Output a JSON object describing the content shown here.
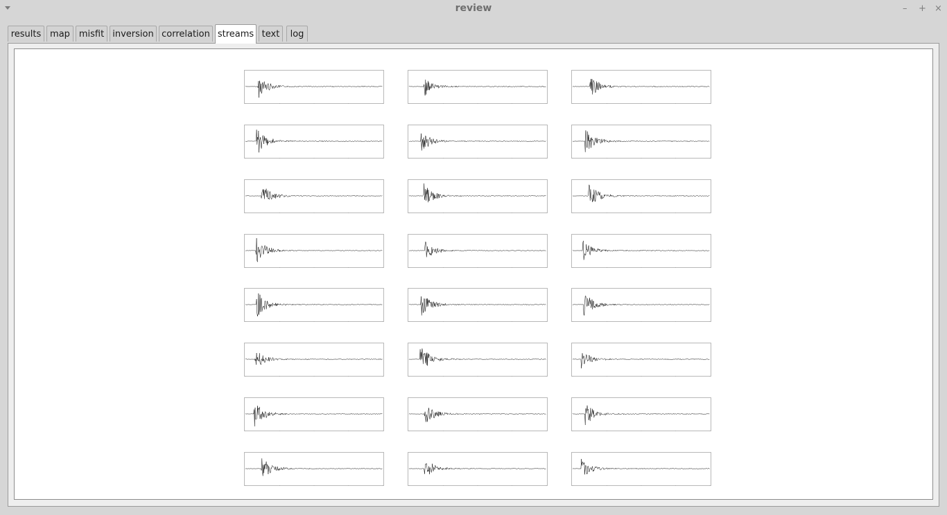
{
  "window": {
    "title": "review",
    "menu_icon": "chevron-down-icon",
    "controls": [
      {
        "name": "minimize",
        "glyph": "–"
      },
      {
        "name": "maximize",
        "glyph": "+"
      },
      {
        "name": "close",
        "glyph": "×"
      }
    ]
  },
  "tabs": [
    {
      "label": "results",
      "active": false
    },
    {
      "label": "map",
      "active": false
    },
    {
      "label": "misfit",
      "active": false
    },
    {
      "label": "inversion",
      "active": false
    },
    {
      "label": "correlation",
      "active": false
    },
    {
      "label": "streams",
      "active": true
    },
    {
      "label": "text",
      "active": false
    },
    {
      "label": "log",
      "active": false
    }
  ],
  "streams": {
    "rows": 8,
    "columns": 3,
    "trace_color": "#000000",
    "frame_color": "#b8b8b8"
  }
}
